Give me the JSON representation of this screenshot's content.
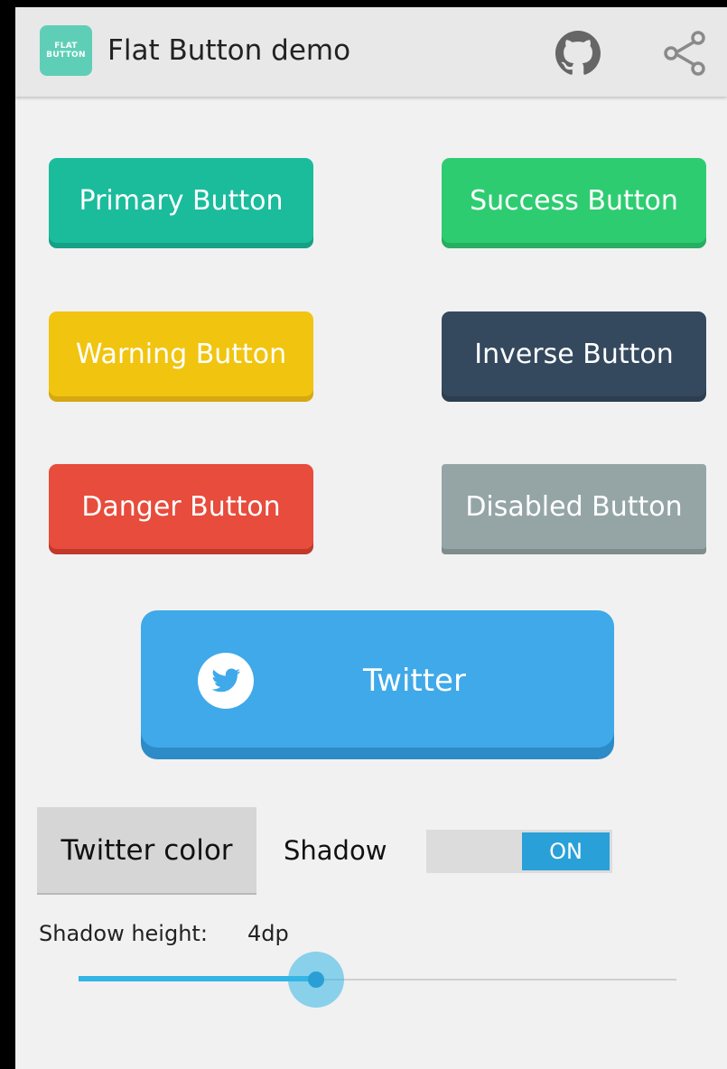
{
  "app": {
    "title": "Flat Button demo",
    "icon_line1": "FLAT",
    "icon_line2": "BUTTON",
    "actions": [
      "github-icon",
      "share-icon"
    ]
  },
  "buttons": {
    "primary": "Primary Button",
    "success": "Success Button",
    "warning": "Warning Button",
    "inverse": "Inverse Button",
    "danger": "Danger Button",
    "disabled": "Disabled Button",
    "twitter": "Twitter"
  },
  "controls": {
    "color_button": "Twitter color",
    "shadow_label": "Shadow",
    "shadow_toggle_state": "ON",
    "shadow_height_label": "Shadow height:",
    "shadow_height_value": "4dp",
    "shadow_height_slider_fraction": 0.4
  },
  "colors": {
    "primary": "#1abc9c",
    "success": "#2ecc71",
    "warning": "#f1c40f",
    "inverse": "#34495e",
    "danger": "#e74c3c",
    "disabled": "#95a5a6",
    "twitter": "#3fa9e9",
    "accent": "#33b5e5"
  }
}
